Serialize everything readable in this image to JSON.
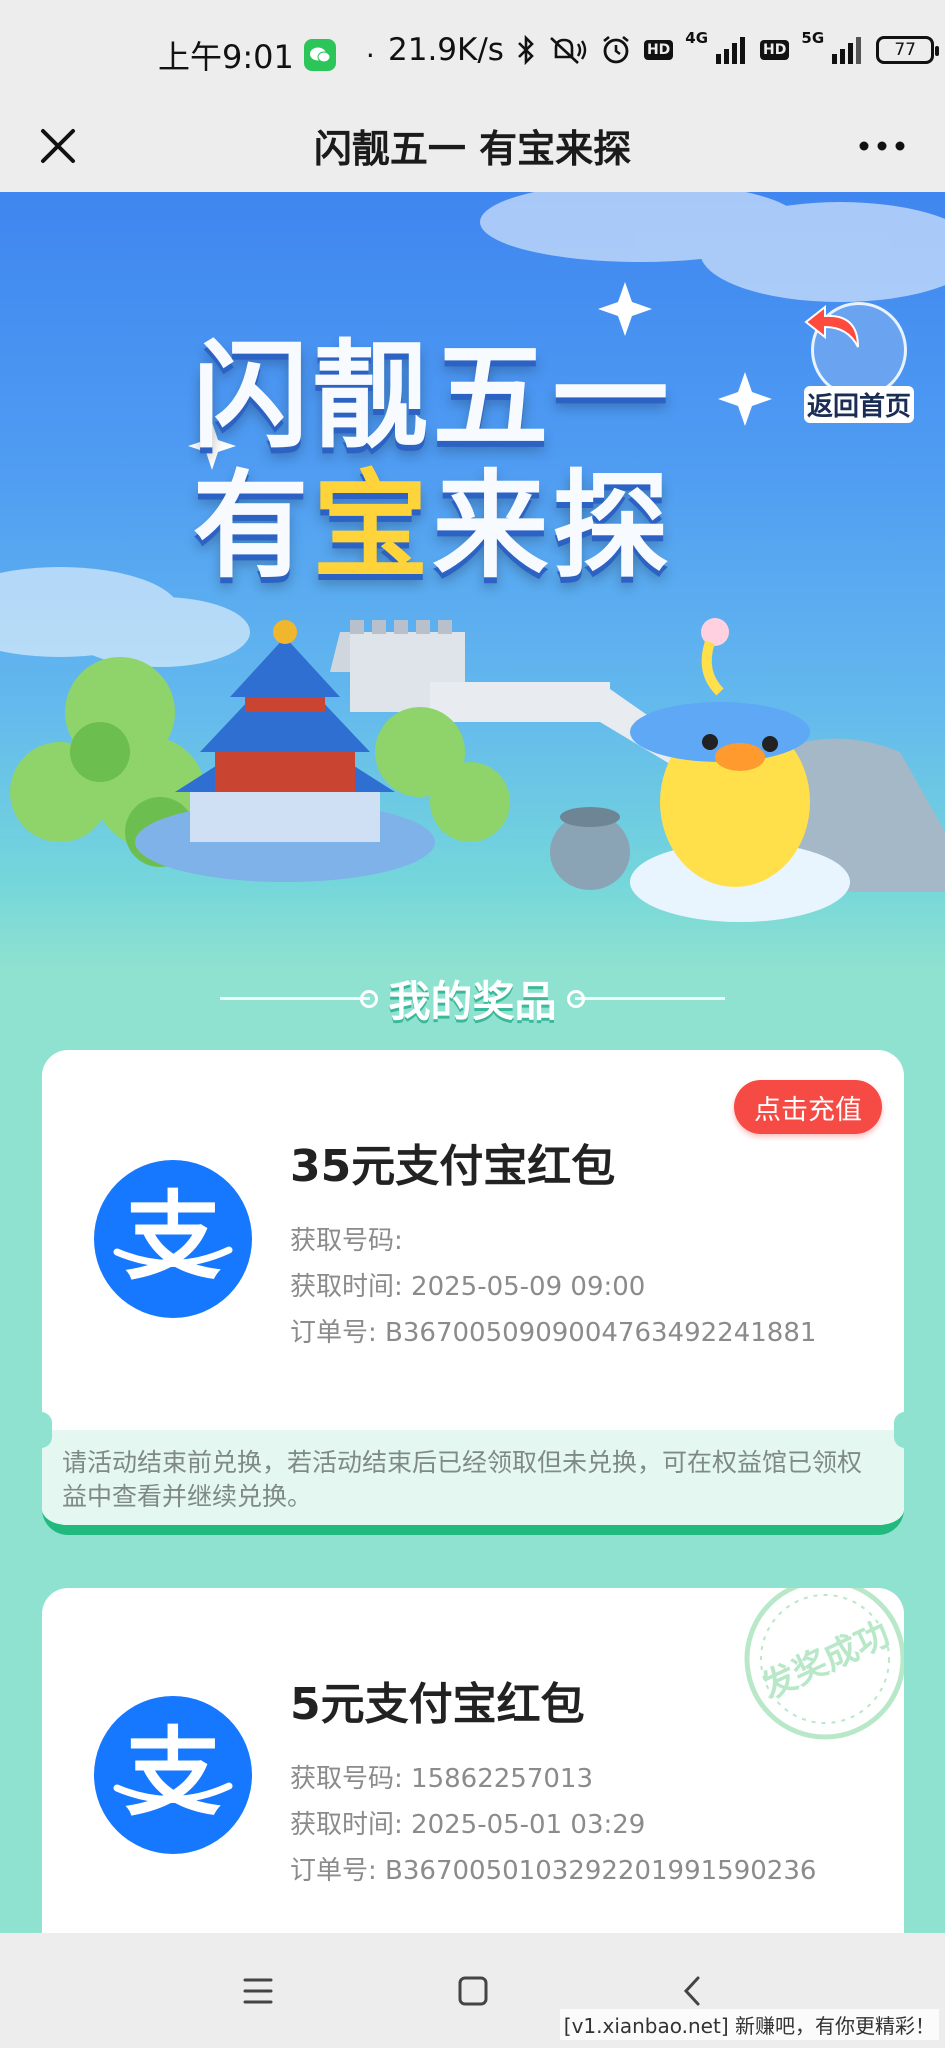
{
  "status_bar": {
    "time": "上午9:01",
    "dot": "·",
    "net_speed": "21.9K/s",
    "net_4g": "4G",
    "net_5g": "5G",
    "battery": "77",
    "icons": [
      "wechat-icon",
      "bluetooth-icon",
      "mute-icon",
      "alarm-icon",
      "hd-icon",
      "signal-icon",
      "battery-icon"
    ]
  },
  "title_bar": {
    "title": "闪靓五一 有宝来探"
  },
  "hero": {
    "line1": "闪靓五一",
    "line2_a": "有",
    "line2_b": "宝",
    "line2_c": "来探",
    "back_home": "返回首页"
  },
  "section": {
    "heading": "我的奖品"
  },
  "prizes": [
    {
      "title": "35元支付宝红包",
      "code_label": "获取号码:",
      "code_value": "",
      "time_label": "获取时间:",
      "time_value": "2025-05-09 09:00",
      "order_label": "订单号:",
      "order_value": "B36700509090047634922418 81",
      "order_full": "B3670050909004763492241881",
      "action": "点击充值",
      "notice": "请活动结束前兑换，若活动结束后已经领取但未兑换，可在权益馆已领权益中查看并继续兑换。",
      "logo_char": "支"
    },
    {
      "title": "5元支付宝红包",
      "code_label": "获取号码:",
      "code_value": "15862257013",
      "time_label": "获取时间:",
      "time_value": "2025-05-01 03:29",
      "order_label": "订单号:",
      "order_full": "B3670050103292201991590236",
      "stamp": "发奖成功",
      "logo_char": "支"
    }
  ],
  "watermark": "[v1.xianbao.net] 新赚吧，有你更精彩！",
  "colors": {
    "accent_red": "#f64a45",
    "alipay_blue": "#1677ff",
    "mint_bg": "#8fe2cf",
    "green_edge": "#22b97e"
  }
}
